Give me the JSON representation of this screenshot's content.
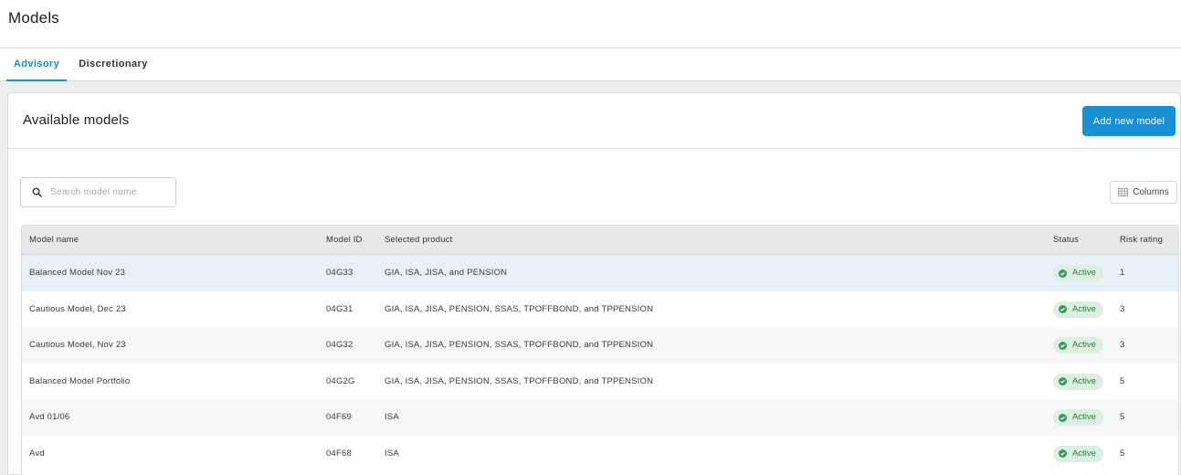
{
  "page": {
    "title": "Models"
  },
  "tabs": [
    {
      "label": "Advisory",
      "active": true
    },
    {
      "label": "Discretionary",
      "active": false
    }
  ],
  "card": {
    "title": "Available models",
    "add_button": "Add new model"
  },
  "search": {
    "placeholder": "Search model name",
    "value": "",
    "icon": "search-icon"
  },
  "columns_button": {
    "label": "Columns",
    "icon": "columns-icon"
  },
  "table": {
    "headers": [
      "Model name",
      "Model ID",
      "Selected product",
      "Status",
      "Risk rating"
    ],
    "rows": [
      {
        "name": "Balanced Model Nov 23",
        "id": "04G33",
        "product": "GIA, ISA, JISA, and PENSION",
        "status": "Active",
        "risk": "1"
      },
      {
        "name": "Cautious Model, Dec 23",
        "id": "04G31",
        "product": "GIA, ISA, JISA, PENSION, SSAS, TPOFFBOND, and TPPENSION",
        "status": "Active",
        "risk": "3"
      },
      {
        "name": "Cautious Model, Nov 23",
        "id": "04G32",
        "product": "GIA, ISA, JISA, PENSION, SSAS, TPOFFBOND, and TPPENSION",
        "status": "Active",
        "risk": "3"
      },
      {
        "name": "Balanced Model Portfolio",
        "id": "04G2G",
        "product": "GIA, ISA, JISA, PENSION, SSAS, TPOFFBOND, and TPPENSION",
        "status": "Active",
        "risk": "5"
      },
      {
        "name": "Avd 01/06",
        "id": "04F69",
        "product": "ISA",
        "status": "Active",
        "risk": "5"
      },
      {
        "name": "Avd",
        "id": "04F68",
        "product": "ISA",
        "status": "Active",
        "risk": "5"
      }
    ]
  },
  "colors": {
    "accent": "#1a8fd4",
    "status_active_bg": "#dcefe1",
    "status_active_fg": "#2f7a46",
    "selected_row": "#e8f1fa"
  }
}
